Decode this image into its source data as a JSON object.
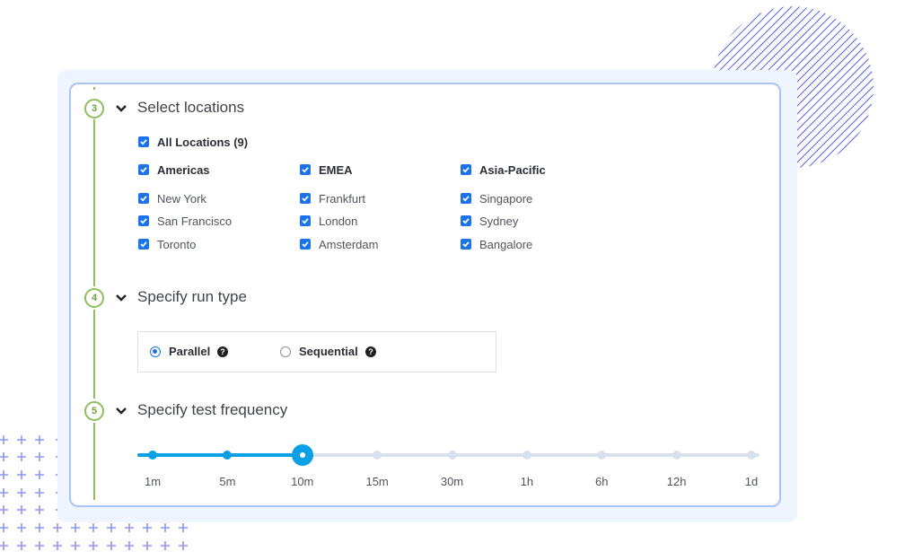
{
  "colors": {
    "accent": "#1a73e8",
    "step_green": "#8fbd5f",
    "slider_active": "#0aa0e6",
    "slider_inactive": "#d9e0ee",
    "card_border": "#a9c4f5",
    "panel_bg": "#eef5ff"
  },
  "steps": [
    {
      "number": "3",
      "title": "Select locations",
      "all_locations": {
        "label": "All Locations (9)",
        "checked": true
      },
      "regions": [
        {
          "label": "Americas",
          "checked": true,
          "cities": [
            {
              "label": "New York",
              "checked": true
            },
            {
              "label": "San Francisco",
              "checked": true
            },
            {
              "label": "Toronto",
              "checked": true
            }
          ]
        },
        {
          "label": "EMEA",
          "checked": true,
          "cities": [
            {
              "label": "Frankfurt",
              "checked": true
            },
            {
              "label": "London",
              "checked": true
            },
            {
              "label": "Amsterdam",
              "checked": true
            }
          ]
        },
        {
          "label": "Asia-Pacific",
          "checked": true,
          "cities": [
            {
              "label": "Singapore",
              "checked": true
            },
            {
              "label": "Sydney",
              "checked": true
            },
            {
              "label": "Bangalore",
              "checked": true
            }
          ]
        }
      ]
    },
    {
      "number": "4",
      "title": "Specify run type",
      "options": [
        {
          "label": "Parallel",
          "selected": true,
          "help_icon": "question-circle-icon"
        },
        {
          "label": "Sequential",
          "selected": false,
          "help_icon": "question-circle-icon"
        }
      ]
    },
    {
      "number": "5",
      "title": "Specify test frequency",
      "frequency_options": [
        "1m",
        "5m",
        "10m",
        "15m",
        "30m",
        "1h",
        "6h",
        "12h",
        "1d"
      ],
      "selected_index": 2,
      "selected_value": "10m"
    }
  ]
}
